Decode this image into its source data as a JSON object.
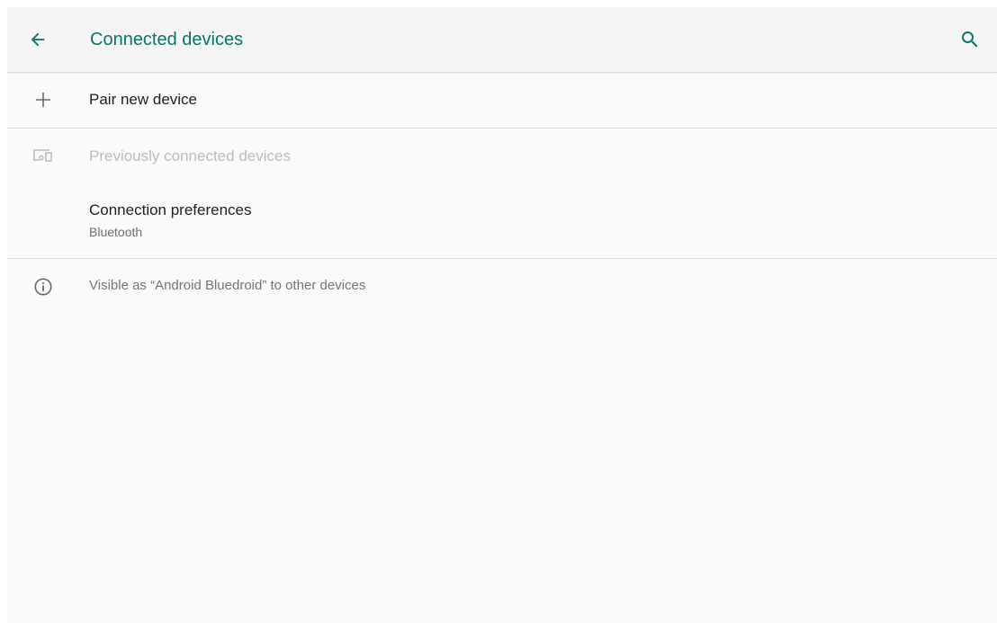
{
  "app_bar": {
    "title": "Connected devices",
    "back_icon": "arrow-left-icon",
    "search_icon": "search-icon",
    "accent_color": "#00796b"
  },
  "items": [
    {
      "icon": "plus-icon",
      "title": "Pair new device",
      "enabled": true
    },
    {
      "icon": "devices-icon",
      "title": "Previously connected devices",
      "enabled": false
    },
    {
      "icon": "",
      "title": "Connection preferences",
      "summary": "Bluetooth",
      "enabled": true
    }
  ],
  "footer": {
    "icon": "info-icon",
    "text": "Visible as “Android Bluedroid” to other devices"
  }
}
